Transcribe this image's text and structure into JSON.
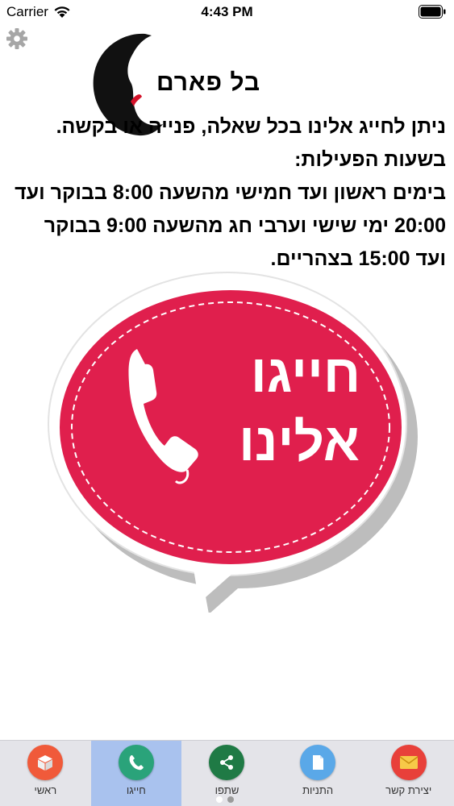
{
  "status_bar": {
    "carrier": "Carrier",
    "time": "4:43 PM"
  },
  "header": {
    "logo_text": "בל פארם"
  },
  "info": {
    "line1": "ניתן לחייג אלינו בכל שאלה, פנייה או בקשה.",
    "line2": "בשעות הפעילות:",
    "line3": "בימים ראשון ועד חמישי מהשעה 8:00 בבוקר ועד",
    "line4": "20:00 ימי שישי וערבי חג מהשעה 9:00 בבוקר",
    "line5": "ועד 15:00 בצהריים."
  },
  "call_button": {
    "line1": "חייגו",
    "line2": "אלינו"
  },
  "tabs": [
    {
      "label": "ראשי",
      "icon": "home-cube-icon",
      "color": "#f05a3a"
    },
    {
      "label": "חייגו",
      "icon": "phone-icon",
      "color": "#2aa37a"
    },
    {
      "label": "שתפו",
      "icon": "share-icon",
      "color": "#1f7a45"
    },
    {
      "label": "התניות",
      "icon": "document-icon",
      "color": "#5aa8e8"
    },
    {
      "label": "יצירת קשר",
      "icon": "envelope-icon",
      "color": "#e8403a"
    }
  ],
  "colors": {
    "accent_red": "#e01f4d",
    "active_tab": "#a9c2ee",
    "tab_bar": "#e4e4e9"
  }
}
